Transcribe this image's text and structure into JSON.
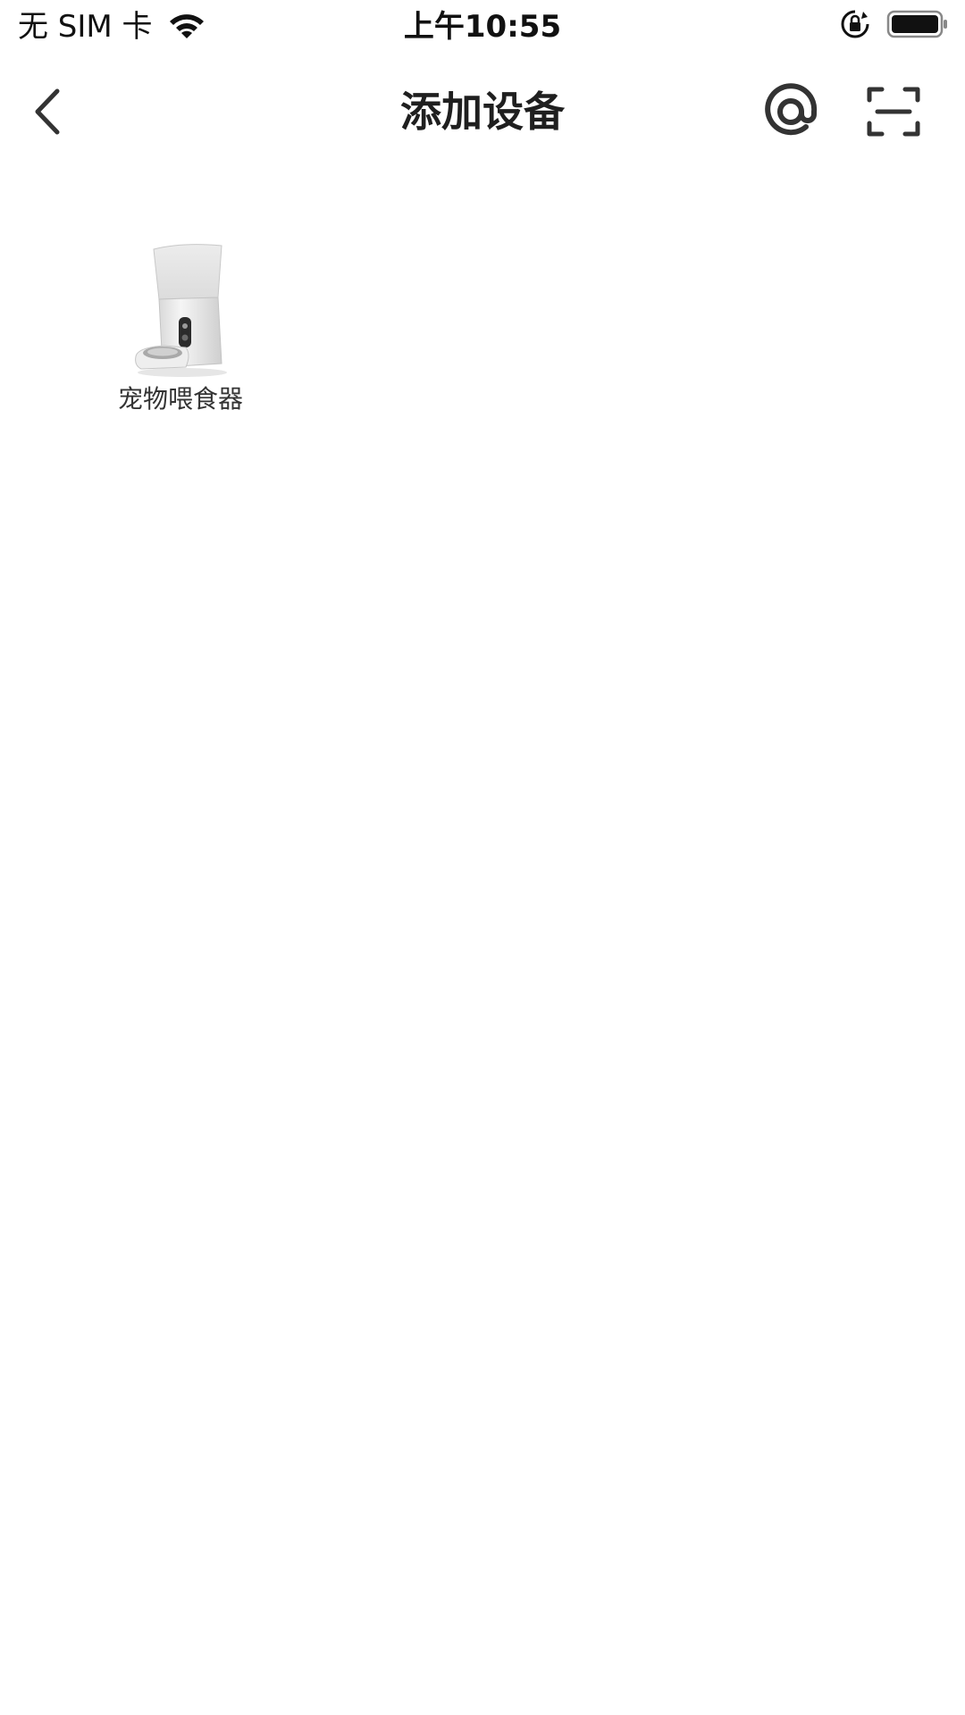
{
  "status_bar": {
    "carrier": "无 SIM 卡",
    "time": "上午10:55",
    "icons": [
      "wifi-icon",
      "orientation-lock-icon",
      "battery-icon"
    ]
  },
  "nav": {
    "title": "添加设备",
    "back_icon": "chevron-left-icon",
    "actions": [
      "at-sign-icon",
      "scan-icon"
    ]
  },
  "devices": [
    {
      "label": "宠物喂食器",
      "image": "pet-feeder-image"
    }
  ],
  "colors": {
    "background": "#ffffff",
    "text": "#1f1f1f",
    "icon": "#333333"
  }
}
